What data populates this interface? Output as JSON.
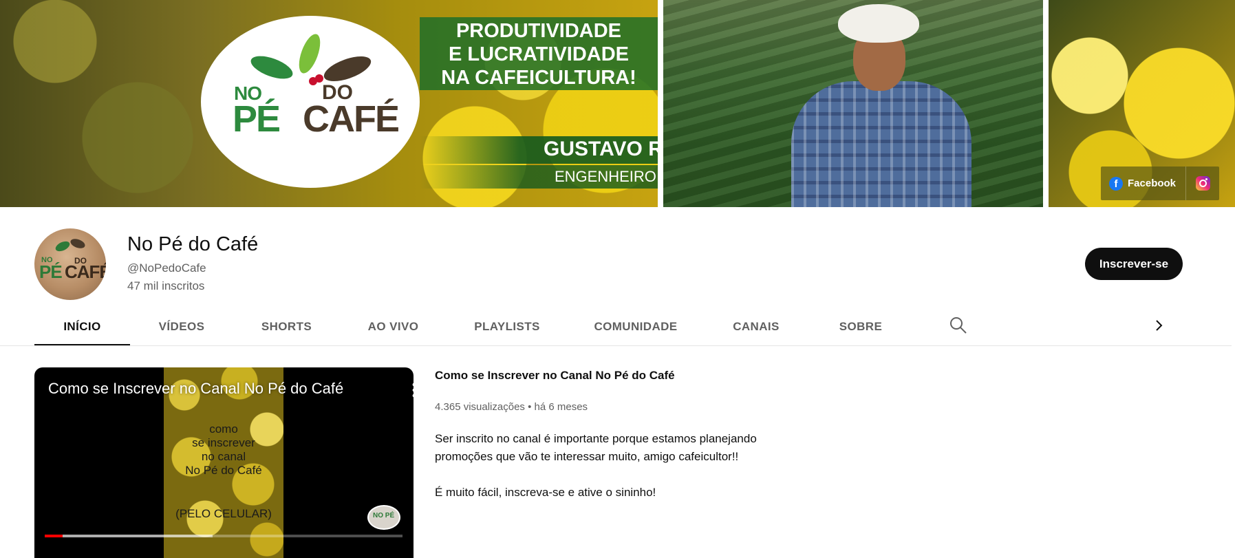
{
  "banner": {
    "logo": {
      "no": "NO",
      "pe": "PÉ",
      "do": "DO",
      "cafe": "CAFÉ"
    },
    "slogan": [
      "PRODUTIVIDADE",
      "E LUCRATIVIDADE",
      "NA CAFEICULTURA!"
    ],
    "presenter_name": "GUSTAVO RENNÓ",
    "presenter_role": "ENGENHEIRO AGRÔNOMO",
    "links": {
      "facebook_label": "Facebook",
      "facebook_icon": "facebook-icon",
      "instagram_icon": "instagram-icon"
    }
  },
  "channel": {
    "avatar_logo": {
      "no": "NO",
      "pe": "PÉ",
      "do": "DO",
      "cafe": "CAFÉ"
    },
    "title": "No Pé do Café",
    "handle": "@NoPedoCafe",
    "subscribers": "47 mil inscritos",
    "subscribe_label": "Inscrever-se"
  },
  "tabs": [
    {
      "label": "INÍCIO",
      "active": true
    },
    {
      "label": "VÍDEOS"
    },
    {
      "label": "SHORTS"
    },
    {
      "label": "AO VIVO"
    },
    {
      "label": "PLAYLISTS"
    },
    {
      "label": "COMUNIDADE"
    },
    {
      "label": "CANAIS"
    },
    {
      "label": "SOBRE"
    }
  ],
  "tab_icons": {
    "search": "search-icon",
    "next": "chevron-right-icon"
  },
  "featured": {
    "player_title": "Como se Inscrever no Canal No Pé do Café",
    "thumbnail_caption": [
      "como",
      "se inscrever",
      "no canal",
      "No Pé do Café",
      "(PELO CELULAR)"
    ],
    "watermark": "NO PÉ",
    "progress_played": 0.05,
    "progress_buffered": 0.47,
    "title": "Como se Inscrever no Canal No Pé do Café",
    "meta": "4.365 visualizações • há 6 meses",
    "description": [
      "Ser inscrito no canal é importante porque estamos planejando",
      "promoções que vão te interessar muito, amigo cafeicultor!!",
      "É muito fácil, inscreva-se e ative o sininho!"
    ]
  },
  "colors": {
    "accent": "#0f0f0f",
    "secondary_text": "#606060",
    "progress_red": "#ff0000",
    "brand_green": "#2d8a3e",
    "brand_brown": "#4a3a2a"
  }
}
